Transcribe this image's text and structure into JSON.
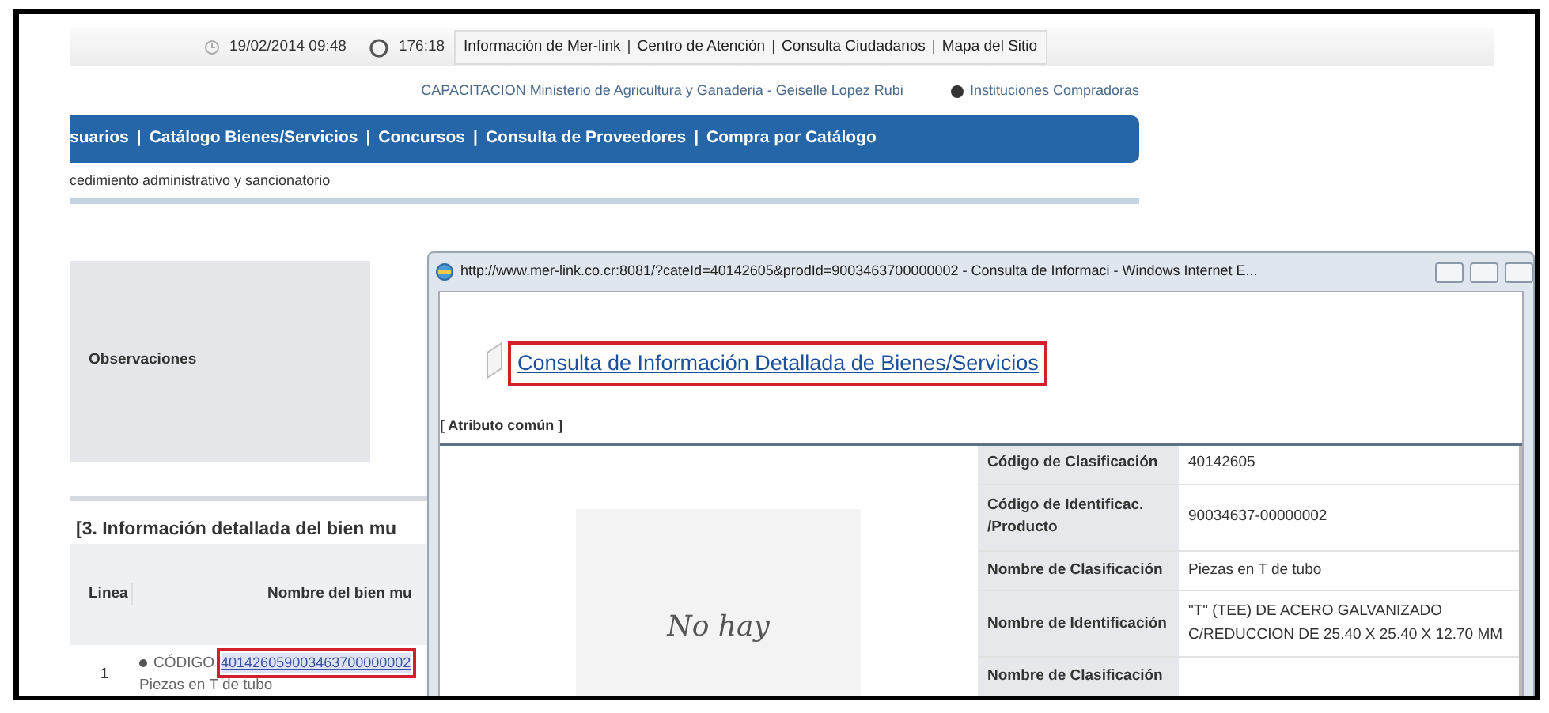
{
  "top_bar": {
    "datetime": "19/02/2014 09:48",
    "session_time": "176:18",
    "separator": "|",
    "links": [
      "Información de Mer-link",
      "Centro de Atención",
      "Consulta Ciudadanos",
      "Mapa del Sitio"
    ]
  },
  "user_line": {
    "text": "CAPACITACION Ministerio de Agricultura y Ganaderia - Geiselle Lopez Rubi",
    "institution_link": "Instituciones Compradoras"
  },
  "nav": {
    "separator": "|",
    "items": [
      "suarios",
      "Catálogo Bienes/Servicios",
      "Concursos",
      "Consulta de Proveedores",
      "Compra por Catálogo"
    ]
  },
  "breadcrumb": "cedimiento administrativo y sancionatorio",
  "observations_label": "Observaciones",
  "section_title": "[3. Información detallada del bien mu",
  "table": {
    "columns": [
      "Linea",
      "Nombre del bien mu"
    ],
    "rows": [
      {
        "line": "1",
        "code_label": "CÓDIGO",
        "code": "401426059003463700000002",
        "code_highlighted": true,
        "name": "Piezas en T de tubo"
      }
    ]
  },
  "popup": {
    "title": "http://www.mer-link.co.cr:8081/?cateId=40142605&prodId=9003463700000002 - Consulta de Informaci - Windows Internet E...",
    "heading": "Consulta de Información Detallada de Bienes/Servicios",
    "heading_highlighted": true,
    "section": "[ Atributo común ]",
    "image_text": "No hay",
    "attributes": [
      {
        "label": "Código de Clasificación",
        "value": "40142605"
      },
      {
        "label": "Código de Identificac. /Producto",
        "value": "90034637-00000002"
      },
      {
        "label": "Nombre de Clasificación",
        "value": "Piezas en T de tubo"
      },
      {
        "label": "Nombre de Identificación",
        "value": "\"T\" (TEE) DE ACERO GALVANIZADO C/REDUCCION DE 25.40 X 25.40 X 12.70 MM"
      },
      {
        "label": "Nombre de Clasificación"
      }
    ]
  }
}
